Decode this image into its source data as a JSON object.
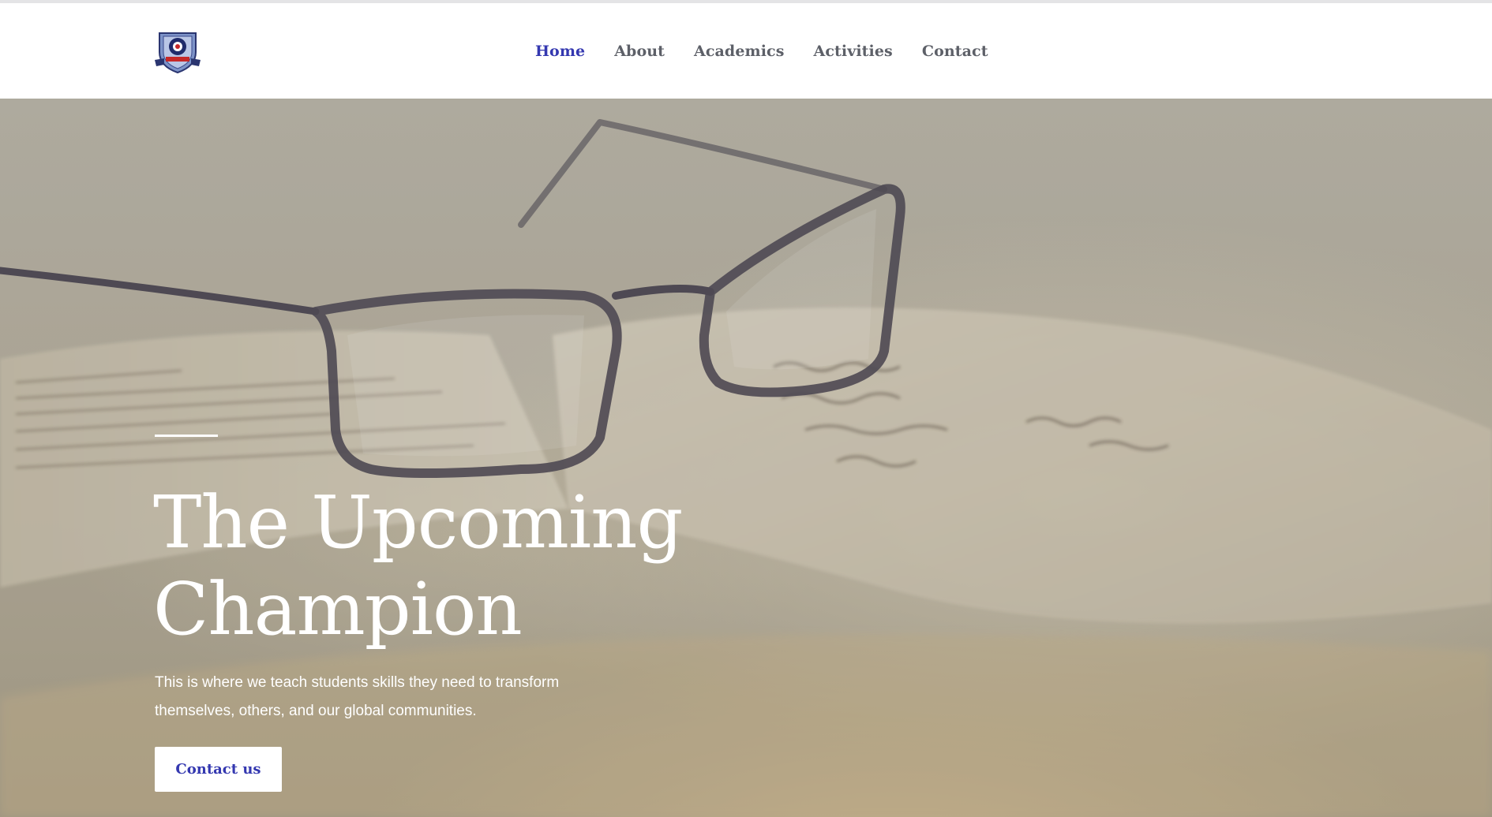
{
  "header": {
    "logo_icon": "school-crest-logo",
    "nav": [
      {
        "label": "Home",
        "active": true
      },
      {
        "label": "About",
        "active": false
      },
      {
        "label": "Academics",
        "active": false
      },
      {
        "label": "Activities",
        "active": false
      },
      {
        "label": "Contact",
        "active": false
      }
    ]
  },
  "hero": {
    "background_image": "eyeglasses-on-open-book",
    "title": "The Upcoming Champion",
    "description": "This is where we teach students skills they need to transform themselves, others, and our global communities.",
    "cta_label": "Contact us"
  },
  "colors": {
    "accent": "#3438b0",
    "nav_text": "#5d6068",
    "hero_text": "#ffffff"
  }
}
